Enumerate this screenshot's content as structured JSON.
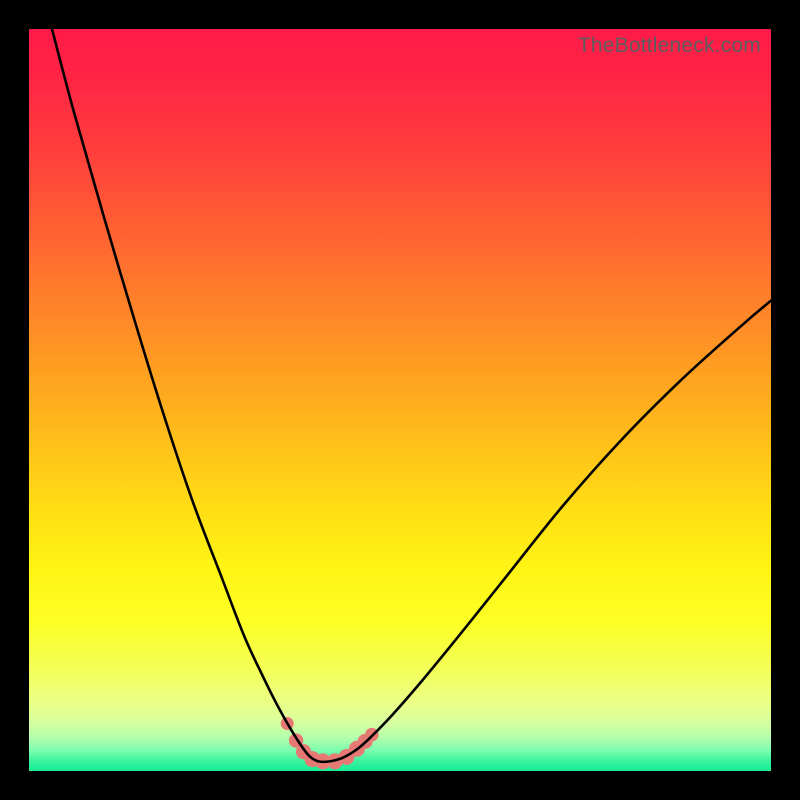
{
  "watermark": "TheBottleneck.com",
  "colors": {
    "frame": "#000000",
    "watermark": "#5d5d5d",
    "curve": "#000000",
    "marker_fill": "#e77974",
    "marker_stroke": "#e46a67",
    "gradient_stops": [
      {
        "offset": 0.0,
        "color": "#ff1b49"
      },
      {
        "offset": 0.06,
        "color": "#ff2345"
      },
      {
        "offset": 0.15,
        "color": "#ff3a3e"
      },
      {
        "offset": 0.25,
        "color": "#ff5a34"
      },
      {
        "offset": 0.35,
        "color": "#ff7b2b"
      },
      {
        "offset": 0.45,
        "color": "#ff9c22"
      },
      {
        "offset": 0.55,
        "color": "#ffbd1a"
      },
      {
        "offset": 0.65,
        "color": "#ffdf14"
      },
      {
        "offset": 0.73,
        "color": "#fff514"
      },
      {
        "offset": 0.8,
        "color": "#fdff26"
      },
      {
        "offset": 0.86,
        "color": "#f3ff55"
      },
      {
        "offset": 0.905,
        "color": "#ecff84"
      },
      {
        "offset": 0.935,
        "color": "#d7ff9f"
      },
      {
        "offset": 0.955,
        "color": "#b3ffad"
      },
      {
        "offset": 0.972,
        "color": "#7dfdae"
      },
      {
        "offset": 0.985,
        "color": "#40f4a0"
      },
      {
        "offset": 1.0,
        "color": "#16eb96"
      }
    ]
  },
  "chart_data": {
    "type": "line",
    "title": "",
    "xlabel": "",
    "ylabel": "",
    "xlim": [
      0,
      100
    ],
    "ylim": [
      0,
      100
    ],
    "series": [
      {
        "name": "bottleneck-curve",
        "x": [
          3.1,
          6,
          10,
          14,
          18,
          22,
          26,
          29,
          31.5,
          33.5,
          35.3,
          36.7,
          37.8,
          39.0,
          40.5,
          42.3,
          44.3,
          46.3,
          49,
          53,
          58,
          64,
          72,
          80,
          88,
          96,
          100
        ],
        "values": [
          100,
          89,
          75,
          61.5,
          48.5,
          36.5,
          26,
          18.2,
          12.8,
          8.8,
          5.6,
          3.4,
          2.0,
          1.3,
          1.3,
          1.8,
          3.0,
          4.8,
          7.6,
          12.2,
          18.3,
          25.8,
          35.8,
          44.8,
          52.8,
          60.0,
          63.4
        ]
      },
      {
        "name": "bottom-markers",
        "x": [
          34.8,
          36.0,
          37.0,
          38.2,
          39.6,
          41.2,
          42.8,
          44.2,
          45.3,
          46.2
        ],
        "values": [
          6.4,
          4.1,
          2.6,
          1.6,
          1.3,
          1.3,
          1.9,
          3.0,
          4.0,
          4.9
        ],
        "r": [
          6.5,
          7.2,
          7.6,
          8.0,
          8.0,
          8.0,
          8.0,
          8.0,
          7.5,
          6.8
        ]
      }
    ]
  }
}
